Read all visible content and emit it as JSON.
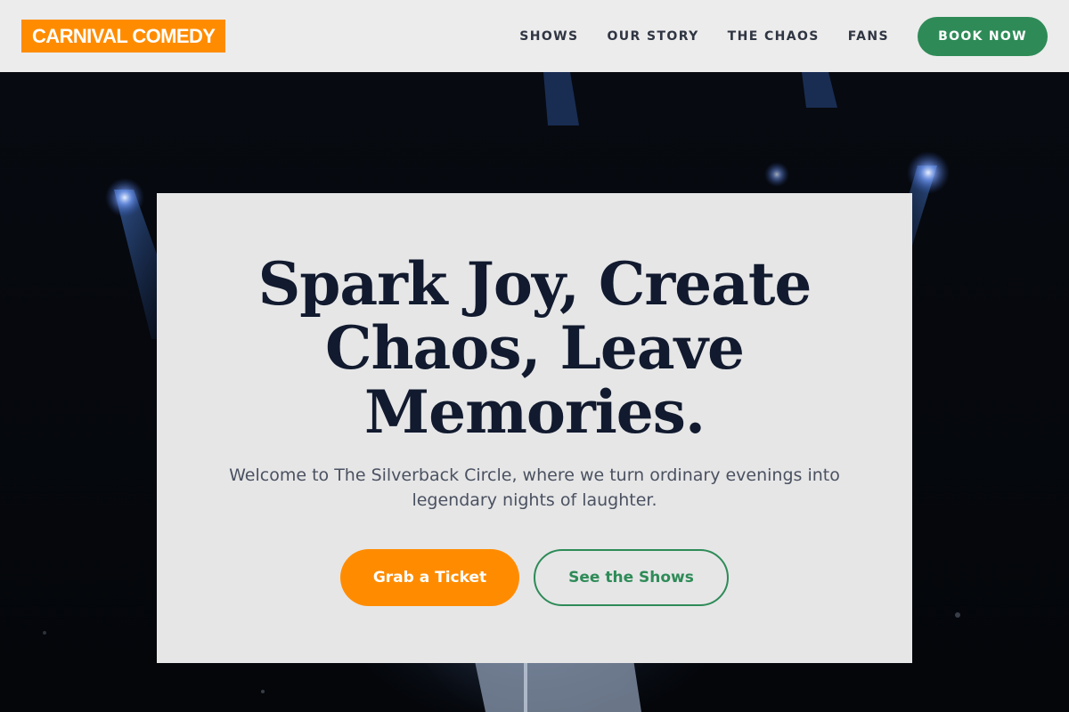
{
  "brand": {
    "logo_text": "CARNIVAL COMEDY",
    "accent_color": "#ff8c00",
    "primary_color": "#2e8b57"
  },
  "nav": {
    "links": [
      {
        "label": "SHOWS"
      },
      {
        "label": "OUR STORY"
      },
      {
        "label": "THE CHAOS"
      },
      {
        "label": "FANS"
      }
    ],
    "cta_label": "BOOK NOW"
  },
  "hero": {
    "background": "stage-performer-photo",
    "headline": "Spark Joy, Create Chaos, Leave Memories.",
    "subtext": "Welcome to The Silverback Circle, where we turn ordinary evenings into legendary nights of laughter.",
    "primary_cta": "Grab a Ticket",
    "secondary_cta": "See the Shows"
  }
}
